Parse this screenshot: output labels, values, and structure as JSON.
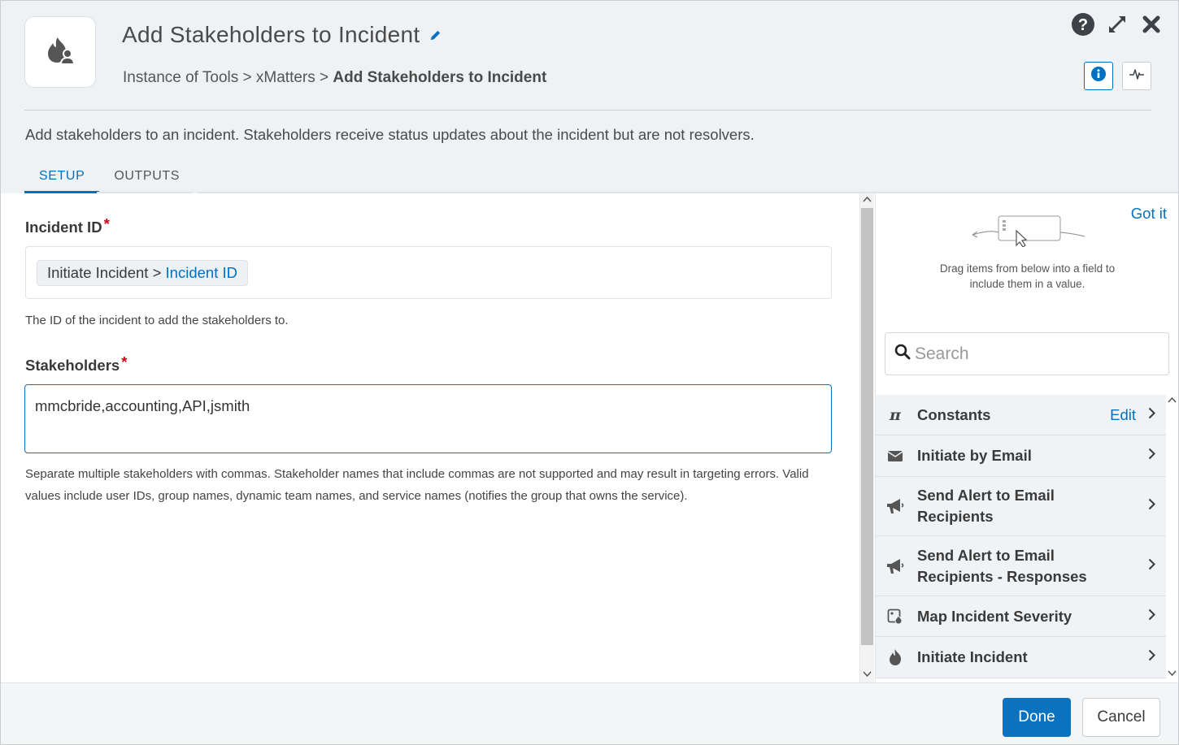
{
  "header": {
    "title": "Add Stakeholders to Incident",
    "breadcrumb": {
      "part1": "Instance of Tools",
      "sep1": " > ",
      "part2": "xMatters",
      "sep2": " > ",
      "current": "Add Stakeholders to Incident"
    },
    "icons": [
      "help-icon",
      "expand-icon",
      "close-icon",
      "info-icon",
      "activity-icon",
      "pencil-icon",
      "fire-user-icon"
    ],
    "description": "Add stakeholders to an incident. Stakeholders receive status updates about the incident but are not resolvers.",
    "tabs": [
      {
        "label": "SETUP",
        "active": true
      },
      {
        "label": "OUTPUTS",
        "active": false
      }
    ]
  },
  "form": {
    "incident_id": {
      "label": "Incident ID",
      "required_mark": "*",
      "token_source": "Initiate Incident",
      "token_sep": " > ",
      "token_field": "Incident ID",
      "help": "The ID of the incident to add the stakeholders to."
    },
    "stakeholders": {
      "label": "Stakeholders",
      "required_mark": "*",
      "value": "mmcbride,accounting,API,jsmith",
      "help": "Separate multiple stakeholders with commas. Stakeholder names that include commas are not supported and may result in targeting errors. Valid values include user IDs, group names, dynamic team names, and service names (notifies the group that owns the service)."
    }
  },
  "panel": {
    "got_it": "Got it",
    "drag_hint_line1": "Drag items from below into a field to",
    "drag_hint_line2": "include them in a value.",
    "search_placeholder": "Search",
    "items": [
      {
        "label": "Constants",
        "icon": "pi-icon",
        "edit": "Edit"
      },
      {
        "label": "Initiate by Email",
        "icon": "envelope-icon"
      },
      {
        "label_line1": "Send Alert to Email",
        "label_line2": "Recipients",
        "icon": "megaphone-icon"
      },
      {
        "label_line1": "Send Alert to Email",
        "label_line2": "Recipients - Responses",
        "icon": "megaphone-icon"
      },
      {
        "label": "Map Incident Severity",
        "icon": "map-severity-icon"
      },
      {
        "label": "Initiate Incident",
        "icon": "fire-icon"
      }
    ]
  },
  "footer": {
    "done_label": "Done",
    "cancel_label": "Cancel"
  },
  "colors": {
    "accent": "#0071c1",
    "primary_button": "#0b72bf",
    "required": "#d0021b",
    "header_bg": "#eff2f5"
  }
}
